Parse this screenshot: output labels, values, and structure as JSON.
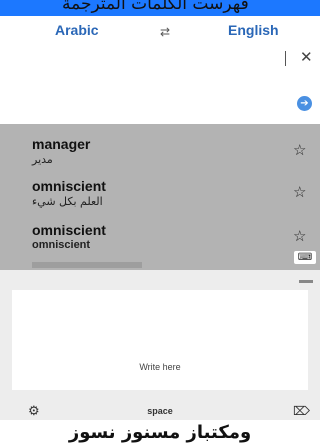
{
  "header": {
    "top_text": "فهرست الكلمات المترجمة",
    "source_language": "Arabic",
    "target_language": "English",
    "swap_icon": "⇄"
  },
  "input": {
    "clear_icon": "✕",
    "go_icon": "➔"
  },
  "results": [
    {
      "word": "manager",
      "translation": "مدير",
      "lang": "ar"
    },
    {
      "word": "omniscient",
      "translation": "العلم بكل شيء",
      "lang": "ar"
    },
    {
      "word": "omniscient",
      "translation": "omniscient",
      "lang": "en"
    }
  ],
  "icons": {
    "star": "☆",
    "keyboard": "⌨",
    "gear": "⚙",
    "backspace": "⌦"
  },
  "handwriting": {
    "placeholder": "Write here"
  },
  "keyboard_bar": {
    "space_label": "space"
  },
  "footer": {
    "text": "ومكتباز مسنوز نسوز"
  },
  "colors": {
    "accent": "#1c78ff",
    "language_text": "#2a67b7",
    "results_bg": "#b3b3b3"
  }
}
